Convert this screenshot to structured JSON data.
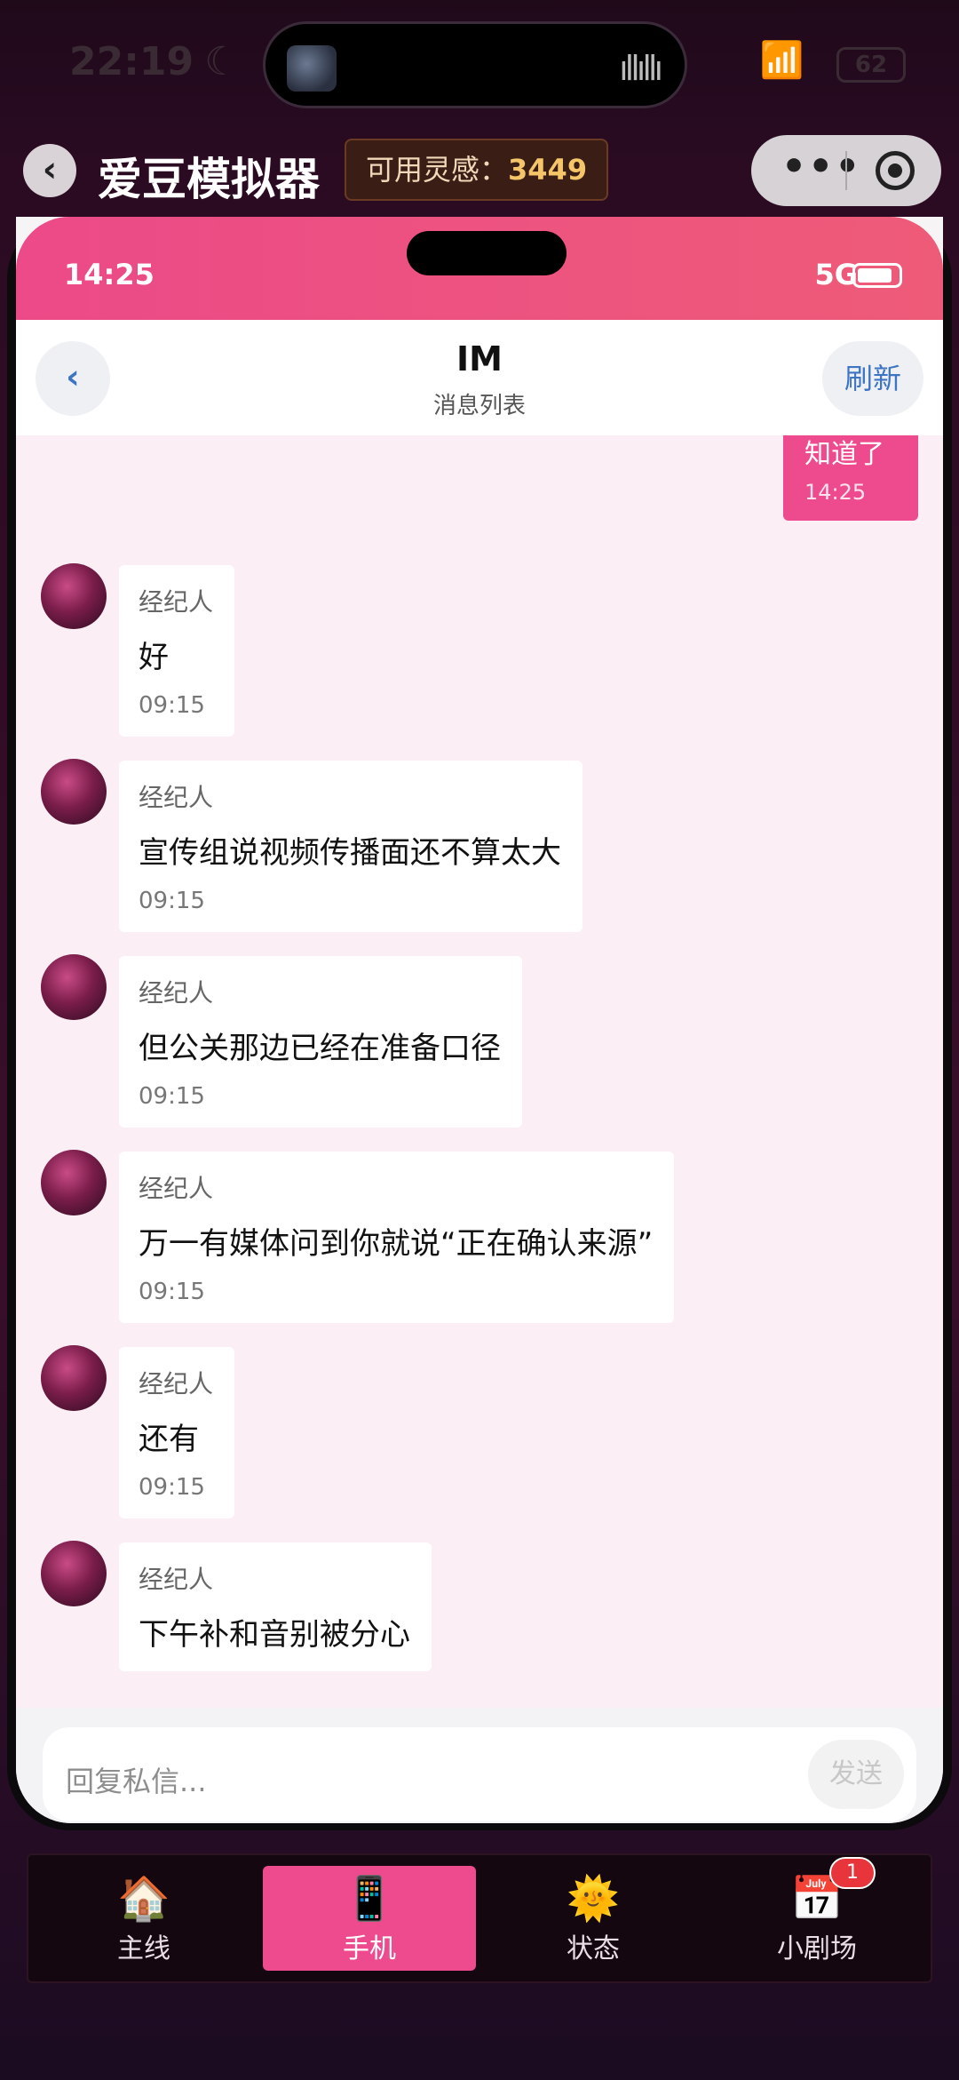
{
  "system": {
    "time": "22:19",
    "moon_icon": "moon-icon",
    "wave_icon": "audio-wave-icon",
    "wifi_icon": "wifi-icon",
    "battery_text": "62"
  },
  "app": {
    "title": "爱豆模拟器",
    "inspiration_label": "可用灵感：",
    "inspiration_value": "3449"
  },
  "phone": {
    "status_time": "14:25",
    "network": "5G",
    "nav": {
      "back_label": "‹",
      "title": "IM",
      "subtitle": "消息列表",
      "refresh_label": "刷新"
    },
    "my_message": {
      "text": "知道了",
      "time": "14:25"
    },
    "messages": [
      {
        "sender": "经纪人",
        "text": "好",
        "time": "09:15"
      },
      {
        "sender": "经纪人",
        "text": "宣传组说视频传播面还不算太大",
        "time": "09:15"
      },
      {
        "sender": "经纪人",
        "text": "但公关那边已经在准备口径",
        "time": "09:15"
      },
      {
        "sender": "经纪人",
        "text": "万一有媒体问到你就说“正在确认来源”",
        "time": "09:15"
      },
      {
        "sender": "经纪人",
        "text": "还有",
        "time": "09:15"
      },
      {
        "sender": "经纪人",
        "text": "下午补和音别被分心",
        "time": ""
      }
    ],
    "composer": {
      "placeholder": "回复私信...",
      "send_label": "发送"
    }
  },
  "tabbar": {
    "items": [
      {
        "label": "主线",
        "icon": "house-icon"
      },
      {
        "label": "手机",
        "icon": "phone-icon"
      },
      {
        "label": "状态",
        "icon": "sun-face-icon"
      },
      {
        "label": "小剧场",
        "icon": "calendar-icon",
        "badge": "1"
      }
    ]
  },
  "colors": {
    "accent": "#ee4a8e",
    "link": "#3d74c4"
  }
}
